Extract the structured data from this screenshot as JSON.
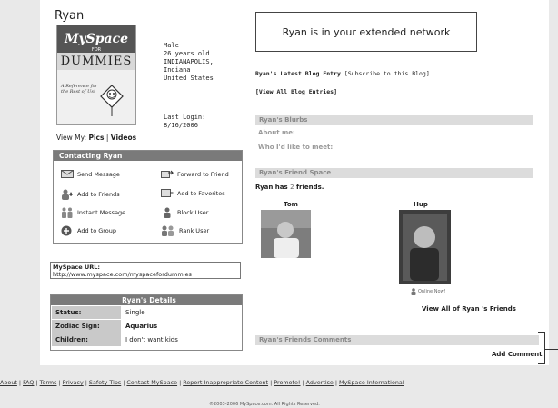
{
  "profile": {
    "name": "Ryan",
    "sex": "Male",
    "age": "26 years old",
    "city": "INDIANAPOLIS,",
    "state": "Indiana",
    "country": "United States",
    "last_login_label": "Last Login:",
    "last_login": "8/16/2006",
    "view_my_label": "View My:",
    "pics": "Pics",
    "sep": "|",
    "videos": "Videos"
  },
  "book": {
    "top_text": "The Fun and Easy Way",
    "title_line1": "MySpace",
    "for": "FOR",
    "title_line2": "DUMMIES",
    "reference": "A Reference for the Rest of Us!"
  },
  "contact": {
    "header": "Contacting Ryan",
    "actions": [
      {
        "label": "Send Message",
        "icon": "envelope-icon"
      },
      {
        "label": "Forward to Friend",
        "icon": "forward-icon"
      },
      {
        "label": "Add to Friends",
        "icon": "add-friend-icon"
      },
      {
        "label": "Add to Favorites",
        "icon": "favorites-icon"
      },
      {
        "label": "Instant Message",
        "icon": "instant-message-icon"
      },
      {
        "label": "Block User",
        "icon": "block-user-icon"
      },
      {
        "label": "Add to Group",
        "icon": "add-group-icon"
      },
      {
        "label": "Rank User",
        "icon": "rank-user-icon"
      }
    ]
  },
  "url": {
    "label": "MySpace URL:",
    "value": "http://www.myspace.com/myspacefordummies"
  },
  "details": {
    "header": "Ryan's Details",
    "rows": [
      {
        "k": "Status:",
        "v": "Single"
      },
      {
        "k": "Zodiac Sign:",
        "v": "Aquarius"
      },
      {
        "k": "Children:",
        "v": "I don't want kids"
      }
    ]
  },
  "main": {
    "extended_network": "Ryan is in your extended network",
    "blog_title": "Ryan's Latest Blog Entry",
    "subscribe": "[Subscribe to this Blog]",
    "view_all_blog": "[View All Blog Entries]",
    "blurbs_header": "Ryan's Blurbs",
    "about_me": "About me:",
    "who_meet": "Who I'd like to meet:",
    "friend_space_header": "Ryan's Friend Space",
    "has_text_1": "Ryan has",
    "friend_count": "2",
    "has_text_2": "friends.",
    "friends": [
      {
        "name": "Tom"
      },
      {
        "name": "Hup"
      }
    ],
    "online_now": "Online Now!",
    "view_all_friends": "View All of Ryan 's Friends",
    "comments_header": "Ryan's Friends Comments",
    "add_comment": "Add Comment"
  },
  "footer": {
    "links": [
      "About",
      "FAQ",
      "Terms",
      "Privacy",
      "Safety Tips",
      "Contact MySpace",
      "Report Inappropriate Content",
      "Promote!",
      "Advertise",
      "MySpace International"
    ],
    "separator": "|",
    "copyright": "©2003-2006 MySpace.com. All Rights Reserved."
  },
  "colors": {
    "header_bg": "#7a7a7a",
    "bar_bg": "#dcdcdc",
    "label_bg": "#c9c9c9"
  }
}
